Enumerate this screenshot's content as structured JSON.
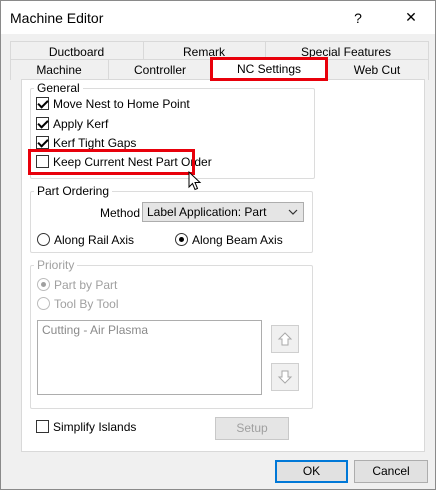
{
  "window": {
    "title": "Machine Editor",
    "help_glyph": "?",
    "close_glyph": "✕"
  },
  "tabs": {
    "row1": [
      "Ductboard",
      "Remark",
      "Special Features"
    ],
    "row2": [
      "Machine",
      "Controller",
      "NC Settings",
      "Web Cut"
    ],
    "active": "NC Settings"
  },
  "general": {
    "label": "General",
    "items": [
      {
        "label": "Move Nest to Home Point",
        "checked": true
      },
      {
        "label": "Apply Kerf",
        "checked": true
      },
      {
        "label": "Kerf Tight Gaps",
        "checked": true
      },
      {
        "label": "Keep Current Nest Part Order",
        "checked": false
      }
    ]
  },
  "part_ordering": {
    "label": "Part Ordering",
    "method_label": "Method",
    "method_value": "Label Application: Part",
    "options": [
      {
        "label": "Along Rail Axis",
        "selected": false
      },
      {
        "label": "Along Beam Axis",
        "selected": true
      }
    ]
  },
  "priority": {
    "label": "Priority",
    "options": [
      {
        "label": "Part by Part",
        "selected": true
      },
      {
        "label": "Tool By Tool",
        "selected": false
      }
    ],
    "list_items": [
      "Cutting - Air Plasma"
    ]
  },
  "simplify_islands": {
    "label": "Simplify Islands",
    "checked": false
  },
  "buttons": {
    "setup": "Setup",
    "ok": "OK",
    "cancel": "Cancel"
  },
  "colors": {
    "highlight": "#e8000b"
  }
}
